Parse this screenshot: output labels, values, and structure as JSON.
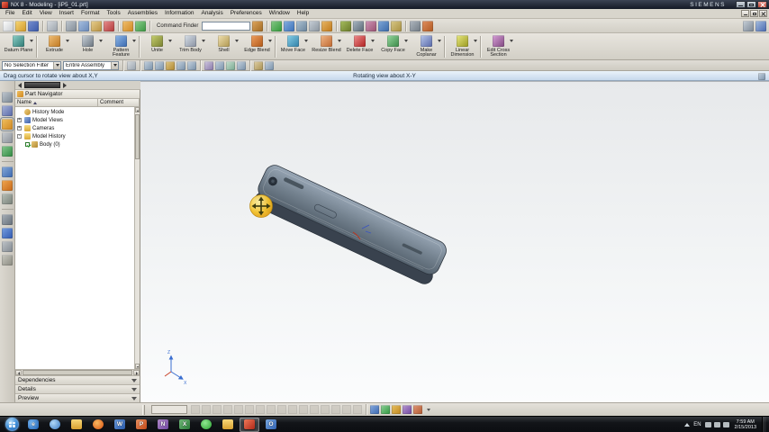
{
  "window": {
    "title": "NX 8 - Modeling - [iP5_01.prt]",
    "brand": "SIEMENS"
  },
  "menu": {
    "items": [
      "File",
      "Edit",
      "View",
      "Insert",
      "Format",
      "Tools",
      "Assemblies",
      "Information",
      "Analysis",
      "Preferences",
      "Window",
      "Help"
    ]
  },
  "toolbar_top": {
    "command_finder_label": "Command Finder",
    "finder_icon_style": "background:linear-gradient(135deg,#e0a860,#a06820)",
    "icons": [
      {
        "name": "new-icon",
        "style": "background:linear-gradient(135deg,#ffffff,#c8ccd0)"
      },
      {
        "name": "open-icon",
        "style": "background:linear-gradient(135deg,#f8d878,#d09828)"
      },
      {
        "name": "save-icon",
        "style": "background:linear-gradient(135deg,#7890d0,#3a58a8)"
      },
      {
        "name": "print-icon",
        "style": "background:linear-gradient(135deg,#d8dce0,#9aa2aa)"
      },
      {
        "name": "cut-icon",
        "style": "background:linear-gradient(135deg,#c0c8d0,#808a94)"
      },
      {
        "name": "copy-icon",
        "style": "background:linear-gradient(135deg,#a8c0e0,#6888b8)"
      },
      {
        "name": "paste-icon",
        "style": "background:linear-gradient(135deg,#e8d090,#b89040)"
      },
      {
        "name": "delete-icon",
        "style": "background:linear-gradient(135deg,#e89090,#b03838)"
      },
      {
        "name": "undo-icon",
        "style": "background:linear-gradient(135deg,#f0c070,#d08820)"
      },
      {
        "name": "redo-icon",
        "style": "background:linear-gradient(135deg,#90d090,#38953f)"
      },
      {
        "name": "refresh-view-icon",
        "style": "background:linear-gradient(135deg,#88c888,#309838)"
      },
      {
        "name": "fit-view-icon",
        "style": "background:linear-gradient(135deg,#88b0e0,#3a70b8)"
      },
      {
        "name": "zoom-icon",
        "style": "background:linear-gradient(135deg,#b0c4d4,#68829a)"
      },
      {
        "name": "pan-icon",
        "style": "background:linear-gradient(135deg,#c8d0d8,#8a949e)"
      },
      {
        "name": "rotate-view-icon",
        "style": "background:linear-gradient(135deg,#e8b868,#c07818)"
      },
      {
        "name": "shaded-view-icon",
        "style": "background:linear-gradient(135deg,#a8c060,#687828)"
      },
      {
        "name": "wireframe-view-icon",
        "style": "background:linear-gradient(135deg,#aab8c4,#5a6874)"
      },
      {
        "name": "face-analysis-icon",
        "style": "background:linear-gradient(135deg,#d098b8,#985070)"
      },
      {
        "name": "orient-view-icon",
        "style": "background:linear-gradient(135deg,#80a8d8,#3a68a8)"
      },
      {
        "name": "snapshot-icon",
        "style": "background:linear-gradient(135deg,#d8c888,#a89040)"
      },
      {
        "name": "show-hide-icon",
        "style": "background:linear-gradient(135deg,#b0b8c0,#707a84)"
      },
      {
        "name": "move-object-icon",
        "style": "background:linear-gradient(135deg,#e09060,#b05820)"
      },
      {
        "name": "full-screen-icon",
        "style": "background:linear-gradient(135deg,#c8d0d8,#7a8694)"
      },
      {
        "name": "help-icon",
        "style": "background:linear-gradient(135deg,#a8c0e0,#4868b0)"
      }
    ]
  },
  "feature_toolbar": {
    "buttons": [
      {
        "label": "Datum Plane",
        "style": "background:linear-gradient(135deg,#8ed0c8,#2e7a74)"
      },
      {
        "label": "Extrude",
        "style": "background:linear-gradient(135deg,#f0c078,#c07820)"
      },
      {
        "label": "Hole",
        "style": "background:linear-gradient(135deg,#ccd4dc,#6a747e)"
      },
      {
        "label": "Pattern Feature",
        "style": "background:linear-gradient(135deg,#90b8e8,#3a6ab0)"
      },
      {
        "label": "Unite",
        "style": "background:linear-gradient(135deg,#c8d070,#788030)"
      },
      {
        "label": "Trim Body",
        "style": "background:linear-gradient(135deg,#d8e0e8,#8890a0)"
      },
      {
        "label": "Shell",
        "style": "background:linear-gradient(135deg,#f0e0b0,#b09850)"
      },
      {
        "label": "Edge Blend",
        "style": "background:linear-gradient(135deg,#f0a060,#b05818)"
      },
      {
        "label": "Move Face",
        "style": "background:linear-gradient(135deg,#88d0e8,#3080a8)"
      },
      {
        "label": "Resize Blend",
        "style": "background:linear-gradient(135deg,#f0b888,#c06830)"
      },
      {
        "label": "Delete Face",
        "style": "background:linear-gradient(135deg,#f09090,#b02020)"
      },
      {
        "label": "Copy Face",
        "style": "background:linear-gradient(135deg,#98d8a0,#3a8a48)"
      },
      {
        "label": "Make Coplanar",
        "style": "background:linear-gradient(135deg,#b8c8ec,#5868a8)"
      },
      {
        "label": "Linear Dimension",
        "style": "background:linear-gradient(135deg,#e8e880,#9a9a20)"
      },
      {
        "label": "Edit Cross Section",
        "style": "background:linear-gradient(135deg,#d8a0d8,#804880)"
      }
    ]
  },
  "filter_bar": {
    "selection_filter": "No Selection Filter",
    "scope": "Entire Assembly",
    "icons": [
      {
        "name": "snap-point-toggle-icon",
        "style": "background:linear-gradient(135deg,#d8dce0,#98a2ac)"
      },
      {
        "name": "end-point-snap-icon",
        "style": "background:linear-gradient(135deg,#c8d4e0,#7890a8)"
      },
      {
        "name": "mid-point-snap-icon",
        "style": "background:linear-gradient(135deg,#c8d4e0,#7890a8)"
      },
      {
        "name": "control-point-snap-icon",
        "style": "background:linear-gradient(135deg,#e0c888,#b08830)"
      },
      {
        "name": "intersection-snap-icon",
        "style": "background:linear-gradient(135deg,#c8d4e0,#7890a8)"
      },
      {
        "name": "arc-center-snap-icon",
        "style": "background:linear-gradient(135deg,#c8d4e0,#7890a8)"
      },
      {
        "name": "quadrant-snap-icon",
        "style": "background:linear-gradient(135deg,#d0c8e0,#8878a8)"
      },
      {
        "name": "existing-point-snap-icon",
        "style": "background:linear-gradient(135deg,#c8d4e0,#7890a8)"
      },
      {
        "name": "point-on-curve-snap-icon",
        "style": "background:linear-gradient(135deg,#c8e0d0,#78a890)"
      },
      {
        "name": "point-on-face-snap-icon",
        "style": "background:linear-gradient(135deg,#c8d4e0,#7890a8)"
      },
      {
        "name": "bounded-grid-snap-icon",
        "style": "background:linear-gradient(135deg,#e0d0a8,#a89050)"
      },
      {
        "name": "magnify-snap-icon",
        "style": "background:linear-gradient(135deg,#c8d4e0,#7890a8)"
      }
    ]
  },
  "status": {
    "prompt": "Drag cursor to rotate view about X,Y",
    "message": "Rotating view about X-Y"
  },
  "resource_bar": {
    "icons": [
      {
        "name": "assembly-navigator-icon",
        "style": "background:linear-gradient(135deg,#c0c8d0,#7a8692)"
      },
      {
        "name": "constraint-navigator-icon",
        "style": "background:linear-gradient(135deg,#a8b4d8,#5868a8)"
      },
      {
        "name": "part-navigator-icon",
        "style": "background:linear-gradient(135deg,#f0c060,#d08820)"
      },
      {
        "name": "reuse-library-icon",
        "style": "background:linear-gradient(135deg,#c8ccd0,#8a9098)"
      },
      {
        "name": "hd3d-tools-icon",
        "style": "background:linear-gradient(135deg,#88c890,#2f8a40)"
      },
      {
        "name": "web-browser-icon",
        "style": "background:linear-gradient(135deg,#88aad8,#3a68b0)"
      },
      {
        "name": "history-palette-icon",
        "style": "background:linear-gradient(135deg,#f0a850,#c86818)"
      },
      {
        "name": "process-studio-icon",
        "style": "background:linear-gradient(135deg,#b8c0b8,#788078)"
      },
      {
        "name": "manufacturing-wizard-icon",
        "style": "background:linear-gradient(135deg,#a8b0b8,#646e78)"
      },
      {
        "name": "roles-icon",
        "style": "background:linear-gradient(135deg,#78a0e0,#3058b0)"
      },
      {
        "name": "system-materials-icon",
        "style": "background:linear-gradient(135deg,#c0c4c8,#808890)"
      },
      {
        "name": "touch-mode-icon",
        "style": "background:linear-gradient(135deg,#c8c8c0,#8a8a80)"
      }
    ]
  },
  "part_navigator": {
    "title": "Part Navigator",
    "icon_style": "background:linear-gradient(135deg,#f0c060,#d08820)",
    "columns": {
      "name": "Name",
      "comment": "Comment"
    },
    "tree": [
      {
        "label": "History Mode",
        "expander": "",
        "icon_style": "background:linear-gradient(135deg,#f0d080,#c09030);border-radius:50%"
      },
      {
        "label": "Model Views",
        "expander": "+",
        "icon_style": "background:linear-gradient(135deg,#90b0e0,#4060a8)"
      },
      {
        "label": "Cameras",
        "expander": "+",
        "icon_style": "background:linear-gradient(180deg,#f8dc80,#d8a838)"
      },
      {
        "label": "Model History",
        "expander": "-",
        "icon_style": "background:linear-gradient(180deg,#f8dc80,#d8a838)"
      },
      {
        "label": "Body (0)",
        "expander": "",
        "icon_style": "background:linear-gradient(135deg,#e8c878,#b08830)"
      }
    ],
    "sections": [
      {
        "label": "Dependencies"
      },
      {
        "label": "Details"
      },
      {
        "label": "Preview"
      }
    ]
  },
  "viewport": {
    "triad": {
      "z": "Z",
      "x": "X"
    }
  },
  "sketch_toolbar": {
    "disabled_icons": [
      "profile-icon",
      "line-icon",
      "arc-icon",
      "circle-icon",
      "fillet-icon",
      "chamfer-icon",
      "rectangle-icon",
      "polygon-icon",
      "studio-spline-icon",
      "point-icon",
      "offset-curve-icon",
      "pattern-curve-icon",
      "intersection-point-icon",
      "quick-trim-icon",
      "quick-extend-icon",
      "make-corner-icon"
    ],
    "colored": [
      {
        "name": "geometric-constraints-icon",
        "style": "background:linear-gradient(135deg,#88aade,#3a68b0)"
      },
      {
        "name": "auto-dimension-icon",
        "style": "background:linear-gradient(135deg,#90d098,#309840)"
      },
      {
        "name": "display-constraints-icon",
        "style": "background:linear-gradient(135deg,#e8c060,#c08820)"
      },
      {
        "name": "convert-reference-icon",
        "style": "background:linear-gradient(135deg,#b898d0,#7048a0)"
      },
      {
        "name": "alternate-solution-icon",
        "style": "background:linear-gradient(135deg,#e09878,#b05830)"
      }
    ]
  },
  "taskbar": {
    "language": "EN",
    "time": "7:59 AM",
    "date": "2/15/2013",
    "apps": [
      {
        "name": "internet-explorer",
        "letter": "e",
        "style": "background:radial-gradient(circle at 35% 35%,#7ab8f0,#1a5cb0);border-radius:3px"
      },
      {
        "name": "media-player",
        "letter": "",
        "style": "background:radial-gradient(circle at 35% 35%,#b0d8f8,#3878c0);border-radius:50%"
      },
      {
        "name": "file-explorer",
        "letter": "",
        "style": "background:linear-gradient(180deg,#f8d878,#d8a030);border-radius:2px"
      },
      {
        "name": "firefox",
        "letter": "",
        "style": "background:radial-gradient(circle at 40% 35%,#f8b860,#d85010);border-radius:50%"
      },
      {
        "name": "word",
        "letter": "W",
        "style": "background:linear-gradient(135deg,#6898d8,#2858a8);border-radius:2px"
      },
      {
        "name": "powerpoint",
        "letter": "P",
        "style": "background:linear-gradient(135deg,#e89060,#c04818);border-radius:2px"
      },
      {
        "name": "onenote",
        "letter": "N",
        "style": "background:linear-gradient(135deg,#b088c8,#7048a0);border-radius:2px"
      },
      {
        "name": "excel",
        "letter": "X",
        "style": "background:linear-gradient(135deg,#70b878,#2a7a38);border-radius:2px"
      },
      {
        "name": "media-app",
        "letter": "",
        "style": "background:radial-gradient(circle at 40% 35%,#90e890,#28a030);border-radius:50%"
      },
      {
        "name": "documents-folder",
        "letter": "",
        "style": "background:linear-gradient(180deg,#f8d878,#d8a030);border-radius:2px"
      },
      {
        "name": "nx-app",
        "letter": "",
        "style": "background:linear-gradient(135deg,#f07858,#b02818);border-radius:2px"
      },
      {
        "name": "outlook",
        "letter": "O",
        "style": "background:linear-gradient(135deg,#78a8e0,#3060b0);border-radius:2px"
      }
    ]
  }
}
